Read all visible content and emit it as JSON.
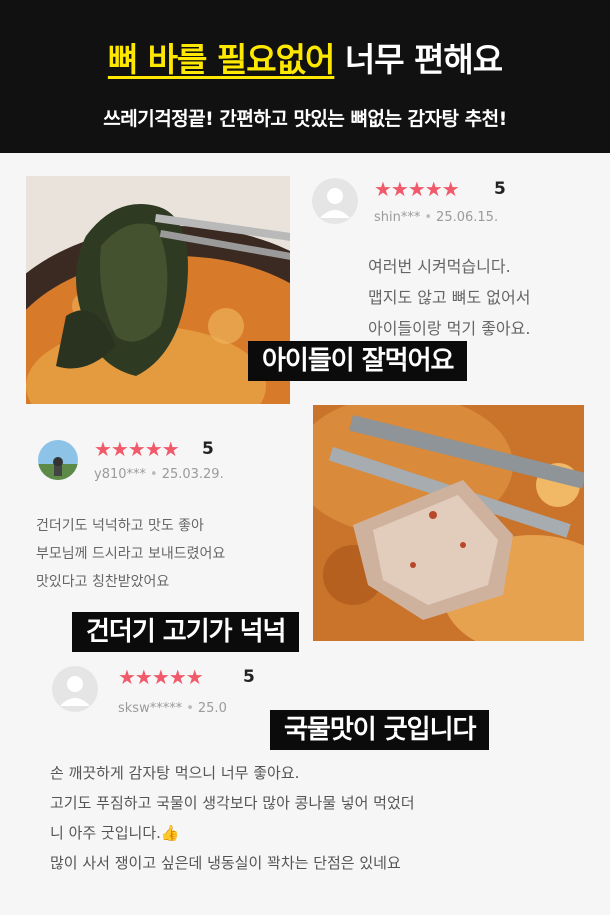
{
  "banner": {
    "highlight": "뼈 바를 필요없어",
    "rest": "너무 편해요",
    "subtitle": "쓰레기걱정끝! 간편하고 맛있는 뼈없는 감자탕 추천!"
  },
  "reviews": [
    {
      "stars": "★★★★★",
      "rating": "5",
      "user": "shin***",
      "date": "25.06.15.",
      "lines": [
        "여러번 시켜먹습니다.",
        "맵지도 않고 뼈도 없어서",
        "아이들이랑 먹기 좋아요."
      ],
      "caption": "아이들이 잘먹어요"
    },
    {
      "stars": "★★★★★",
      "rating": "5",
      "user": "y810***",
      "date": "25.03.29.",
      "lines": [
        "건더기도 넉넉하고 맛도 좋아",
        "부모님께  드시라고 보내드렸어요",
        "맛있다고 칭찬받았어요"
      ],
      "caption": "건더기 고기가 넉넉"
    },
    {
      "stars": "★★★★★",
      "rating": "5",
      "user": "sksw*****",
      "date": "25.0",
      "lines": [
        "손 깨끗하게 감자탕 먹으니 너무 좋아요.",
        "고기도 푸짐하고 국물이 생각보다 많아 콩나물 넣어 먹었더",
        "니 아주 굿입니다.👍",
        "많이 사서 쟁이고 싶은데 냉동실이 꽉차는 단점은 있네요"
      ],
      "caption": "국물맛이 굿입니다"
    }
  ],
  "colors": {
    "star": "#f05a6b",
    "highlight": "#ffe800",
    "banner_bg": "#111111"
  }
}
